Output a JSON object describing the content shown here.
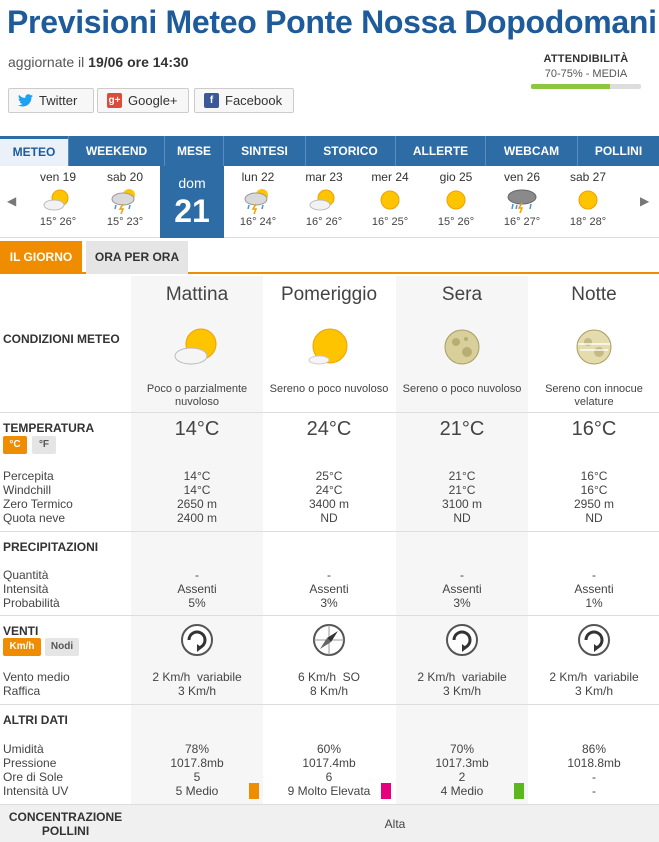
{
  "header": {
    "title": "Previsioni Meteo Ponte Nossa Dopodomani",
    "updated_prefix": "aggiornate il",
    "updated_value": "19/06 ore 14:30",
    "reliability_label": "ATTENDIBILITÀ",
    "reliability_value": "70-75% - MEDIA",
    "reliability_fraction": 0.72,
    "reliability_color": "#8dc63f"
  },
  "social": {
    "twitter": "Twitter",
    "google": "Google+",
    "facebook": "Facebook"
  },
  "nav": [
    "METEO",
    "WEEKEND",
    "MESE",
    "SINTESI",
    "STORICO",
    "ALLERTE",
    "WEBCAM",
    "POLLINI"
  ],
  "days": [
    {
      "name": "ven 19",
      "temps": "15° 26°",
      "icon": "sun-cloud-icon"
    },
    {
      "name": "sab 20",
      "temps": "15° 23°",
      "icon": "storm-icon"
    },
    {
      "name": "dom",
      "num": "21",
      "selected": true
    },
    {
      "name": "lun 22",
      "temps": "16° 24°",
      "icon": "storm-icon"
    },
    {
      "name": "mar 23",
      "temps": "16° 26°",
      "icon": "sun-cloud-icon"
    },
    {
      "name": "mer 24",
      "temps": "16° 25°",
      "icon": "sun-icon"
    },
    {
      "name": "gio 25",
      "temps": "15° 26°",
      "icon": "sun-icon"
    },
    {
      "name": "ven 26",
      "temps": "16° 27°",
      "icon": "storm-heavy-icon"
    },
    {
      "name": "sab 27",
      "temps": "18° 28°",
      "icon": "sun-icon"
    }
  ],
  "subtabs": {
    "day": "IL GIORNO",
    "hourly": "ORA PER ORA"
  },
  "periods": [
    "Mattina",
    "Pomeriggio",
    "Sera",
    "Notte"
  ],
  "conditions": {
    "label": "CONDIZIONI METEO",
    "desc": [
      "Poco o parzialmente nuvoloso",
      "Sereno o poco nuvoloso",
      "Sereno o poco nuvoloso",
      "Sereno con innocue velature"
    ]
  },
  "temperature": {
    "label": "TEMPERATURA",
    "unit_c": "°C",
    "unit_f": "°F",
    "values": [
      "14°C",
      "24°C",
      "21°C",
      "16°C"
    ],
    "rows": [
      {
        "label": "Percepita",
        "values": [
          "14°C",
          "25°C",
          "21°C",
          "16°C"
        ]
      },
      {
        "label": "Windchill",
        "values": [
          "14°C",
          "24°C",
          "21°C",
          "16°C"
        ]
      },
      {
        "label": "Zero Termico",
        "values": [
          "2650 m",
          "3400 m",
          "3100 m",
          "2950 m"
        ]
      },
      {
        "label": "Quota neve",
        "values": [
          "2400 m",
          "ND",
          "ND",
          "ND"
        ]
      }
    ]
  },
  "precip": {
    "label": "PRECIPITAZIONI",
    "rows": [
      {
        "label": "Quantità",
        "values": [
          "-",
          "-",
          "-",
          "-"
        ]
      },
      {
        "label": "Intensità",
        "values": [
          "Assenti",
          "Assenti",
          "Assenti",
          "Assenti"
        ]
      },
      {
        "label": "Probabilità",
        "values": [
          "5%",
          "3%",
          "3%",
          "1%"
        ]
      }
    ]
  },
  "wind": {
    "label": "VENTI",
    "unit_kmh": "Km/h",
    "unit_knots": "Nodi",
    "rows": [
      {
        "label": "Vento medio",
        "values": [
          "2 Km/h  variabile",
          "6 Km/h  SO",
          "2 Km/h  variabile",
          "2 Km/h  variabile"
        ]
      },
      {
        "label": "Raffica",
        "values": [
          "3 Km/h",
          "8 Km/h",
          "3 Km/h",
          "3 Km/h"
        ]
      }
    ]
  },
  "other": {
    "label": "ALTRI DATI",
    "rows": [
      {
        "label": "Umidità",
        "values": [
          "78%",
          "60%",
          "70%",
          "86%"
        ]
      },
      {
        "label": "Pressione",
        "values": [
          "1017.8mb",
          "1017.4mb",
          "1017.3mb",
          "1018.8mb"
        ]
      },
      {
        "label": "Ore di Sole",
        "values": [
          "5",
          "6",
          "2",
          "-"
        ]
      },
      {
        "label": "Intensità UV",
        "values": [
          "5 Medio",
          "9 Molto Elevata",
          "4 Medio",
          "-"
        ]
      }
    ],
    "uv_colors": [
      "#f08c00",
      "#e6007e",
      "#5ab81e",
      ""
    ]
  },
  "pollen": {
    "label": "CONCENTRAZIONE POLLINI",
    "value": "Alta"
  }
}
